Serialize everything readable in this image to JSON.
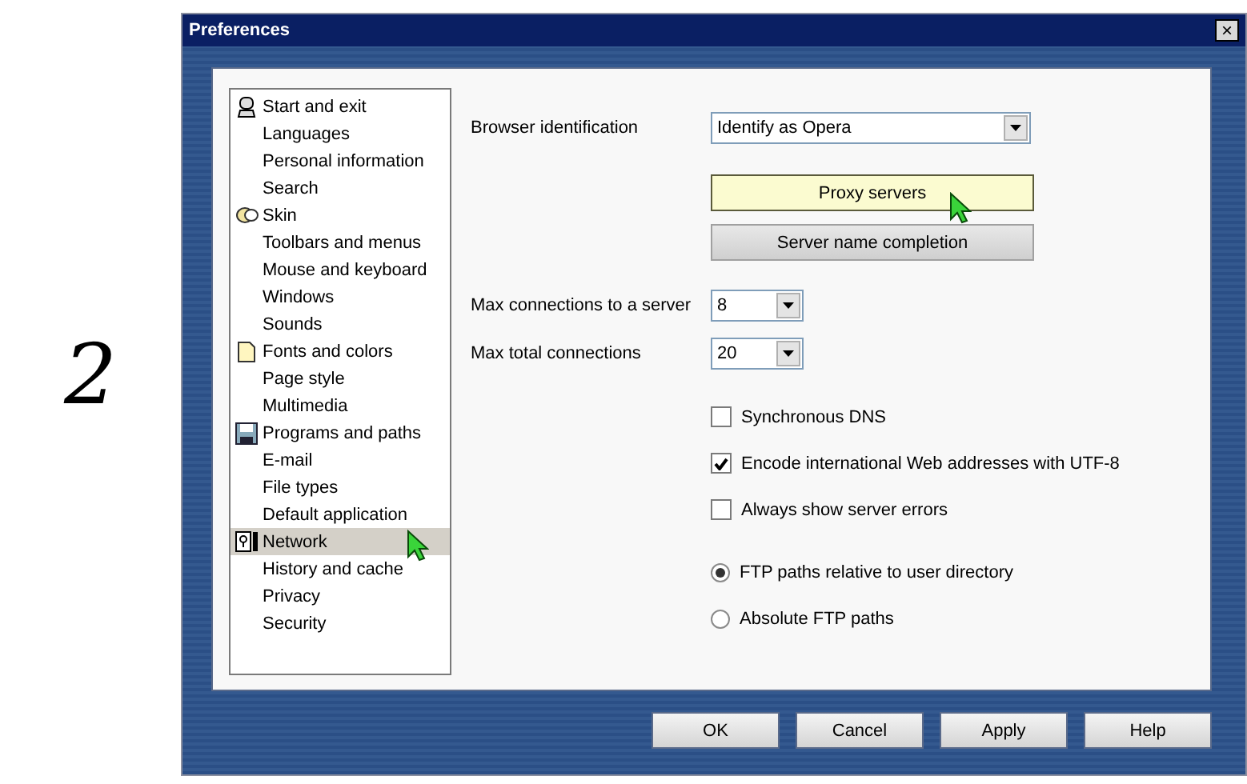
{
  "step_number": "2",
  "window": {
    "title": "Preferences",
    "close": "×"
  },
  "sidebar": {
    "items": [
      {
        "label": "Start and exit",
        "kind": "category",
        "selected": false
      },
      {
        "label": "Languages",
        "kind": "page",
        "selected": false
      },
      {
        "label": "Personal information",
        "kind": "page",
        "selected": false
      },
      {
        "label": "Search",
        "kind": "page",
        "selected": false
      },
      {
        "label": "Skin",
        "kind": "category",
        "selected": false
      },
      {
        "label": "Toolbars and menus",
        "kind": "page",
        "selected": false
      },
      {
        "label": "Mouse and keyboard",
        "kind": "page",
        "selected": false
      },
      {
        "label": "Windows",
        "kind": "page",
        "selected": false
      },
      {
        "label": "Sounds",
        "kind": "page",
        "selected": false
      },
      {
        "label": "Fonts and colors",
        "kind": "category",
        "selected": false
      },
      {
        "label": "Page style",
        "kind": "page",
        "selected": false
      },
      {
        "label": "Multimedia",
        "kind": "page",
        "selected": false
      },
      {
        "label": "Programs and paths",
        "kind": "category",
        "selected": false
      },
      {
        "label": "E-mail",
        "kind": "page",
        "selected": false
      },
      {
        "label": "File types",
        "kind": "page",
        "selected": false
      },
      {
        "label": "Default application",
        "kind": "page",
        "selected": false
      },
      {
        "label": "Network",
        "kind": "category",
        "selected": true
      },
      {
        "label": "History and cache",
        "kind": "page",
        "selected": false
      },
      {
        "label": "Privacy",
        "kind": "page",
        "selected": false
      },
      {
        "label": "Security",
        "kind": "page",
        "selected": false
      }
    ]
  },
  "browser_identification": {
    "label": "Browser identification",
    "value": "Identify as Opera"
  },
  "action_buttons": [
    {
      "label": "Proxy servers",
      "highlighted": true
    },
    {
      "label": "Server name completion",
      "highlighted": false
    }
  ],
  "connections": [
    {
      "label": "Max connections to a server",
      "value": "8"
    },
    {
      "label": "Max total connections",
      "value": "20"
    }
  ],
  "checkboxes": [
    {
      "label": "Synchronous DNS",
      "checked": false
    },
    {
      "label": "Encode international Web addresses with UTF-8",
      "checked": true
    },
    {
      "label": "Always show server errors",
      "checked": false
    }
  ],
  "ftp_paths": [
    {
      "label": "FTP paths relative to user directory",
      "selected": true
    },
    {
      "label": "Absolute FTP paths",
      "selected": false
    }
  ],
  "buttons": [
    "OK",
    "Cancel",
    "Apply",
    "Help"
  ]
}
